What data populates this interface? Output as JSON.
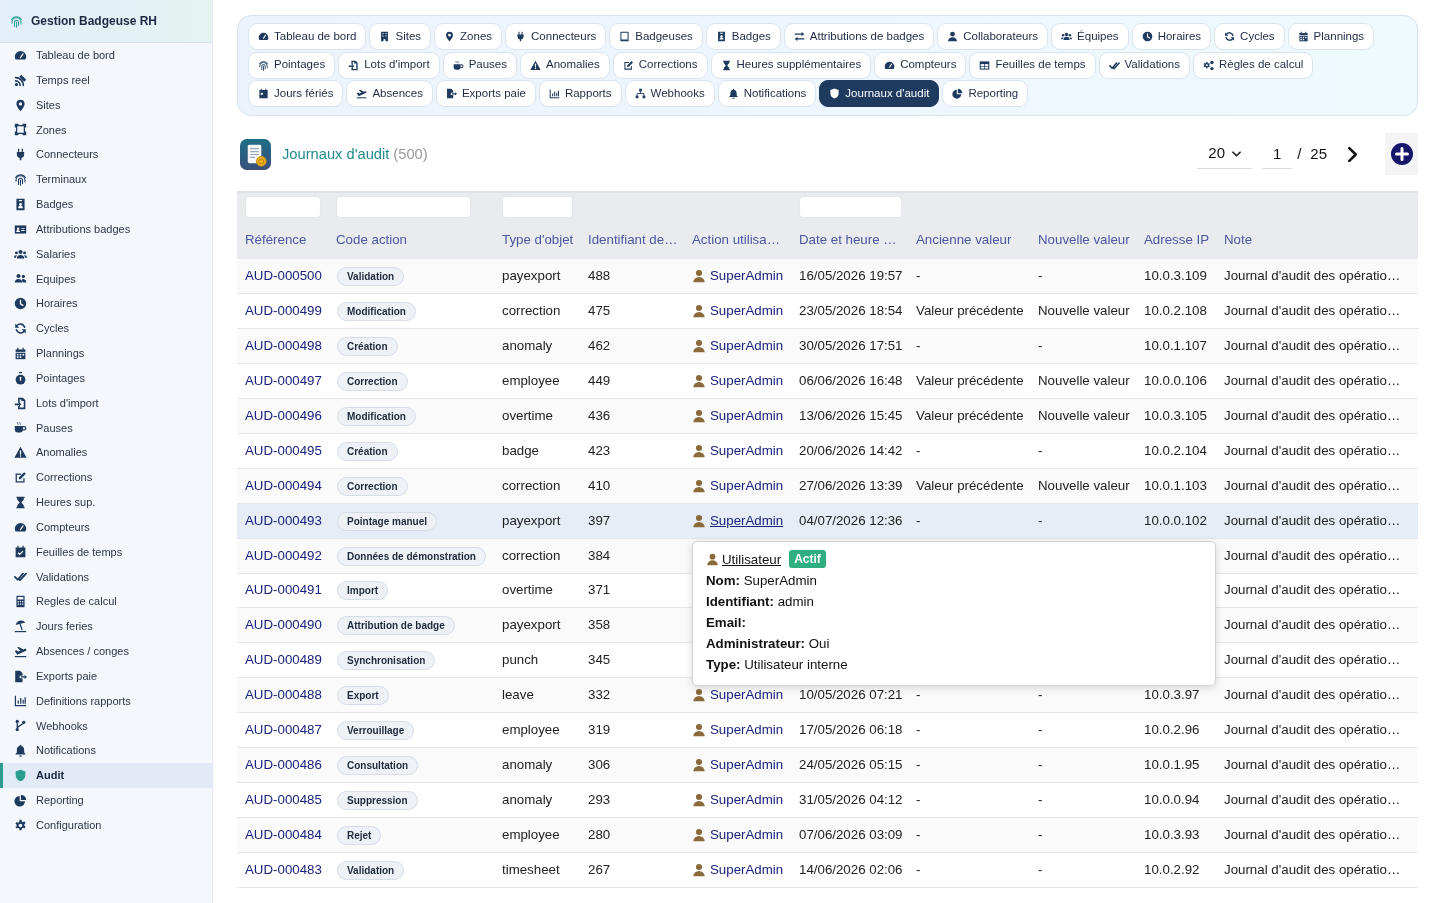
{
  "sidebar": {
    "title": "Gestion Badgeuse RH",
    "items": [
      {
        "label": "Tableau de bord",
        "selected": false
      },
      {
        "label": "Temps reel",
        "selected": false
      },
      {
        "label": "Sites",
        "selected": false
      },
      {
        "label": "Zones",
        "selected": false
      },
      {
        "label": "Connecteurs",
        "selected": false
      },
      {
        "label": "Terminaux",
        "selected": false
      },
      {
        "label": "Badges",
        "selected": false
      },
      {
        "label": "Attributions badges",
        "selected": false
      },
      {
        "label": "Salaries",
        "selected": false
      },
      {
        "label": "Equipes",
        "selected": false
      },
      {
        "label": "Horaires",
        "selected": false
      },
      {
        "label": "Cycles",
        "selected": false
      },
      {
        "label": "Plannings",
        "selected": false
      },
      {
        "label": "Pointages",
        "selected": false
      },
      {
        "label": "Lots d'import",
        "selected": false
      },
      {
        "label": "Pauses",
        "selected": false
      },
      {
        "label": "Anomalies",
        "selected": false
      },
      {
        "label": "Corrections",
        "selected": false
      },
      {
        "label": "Heures sup.",
        "selected": false
      },
      {
        "label": "Compteurs",
        "selected": false
      },
      {
        "label": "Feuilles de temps",
        "selected": false
      },
      {
        "label": "Validations",
        "selected": false
      },
      {
        "label": "Regles de calcul",
        "selected": false
      },
      {
        "label": "Jours feries",
        "selected": false
      },
      {
        "label": "Absences / conges",
        "selected": false
      },
      {
        "label": "Exports paie",
        "selected": false
      },
      {
        "label": "Definitions rapports",
        "selected": false
      },
      {
        "label": "Webhooks",
        "selected": false
      },
      {
        "label": "Notifications",
        "selected": false
      },
      {
        "label": "Audit",
        "selected": true
      },
      {
        "label": "Reporting",
        "selected": false
      },
      {
        "label": "Configuration",
        "selected": false
      }
    ]
  },
  "tab_rows": [
    [
      {
        "label": "Tableau de bord",
        "selected": false
      },
      {
        "label": "Sites",
        "selected": false
      },
      {
        "label": "Zones",
        "selected": false
      },
      {
        "label": "Connecteurs",
        "selected": false
      },
      {
        "label": "Badgeuses",
        "selected": false
      },
      {
        "label": "Badges",
        "selected": false
      },
      {
        "label": "Attributions de badges",
        "selected": false
      },
      {
        "label": "Collaborateurs",
        "selected": false
      },
      {
        "label": "Équipes",
        "selected": false
      },
      {
        "label": "Horaires",
        "selected": false
      },
      {
        "label": "Cycles",
        "selected": false
      },
      {
        "label": "Plannings",
        "selected": false
      }
    ],
    [
      {
        "label": "Pointages",
        "selected": false
      },
      {
        "label": "Lots d'import",
        "selected": false
      },
      {
        "label": "Pauses",
        "selected": false
      },
      {
        "label": "Anomalies",
        "selected": false
      },
      {
        "label": "Corrections",
        "selected": false
      },
      {
        "label": "Heures supplémentaires",
        "selected": false
      },
      {
        "label": "Compteurs",
        "selected": false
      },
      {
        "label": "Feuilles de temps",
        "selected": false
      },
      {
        "label": "Validations",
        "selected": false
      },
      {
        "label": "Règles de calcul",
        "selected": false
      }
    ],
    [
      {
        "label": "Jours fériés",
        "selected": false
      },
      {
        "label": "Absences",
        "selected": false
      },
      {
        "label": "Exports paie",
        "selected": false
      },
      {
        "label": "Rapports",
        "selected": false
      },
      {
        "label": "Webhooks",
        "selected": false
      },
      {
        "label": "Notifications",
        "selected": false
      },
      {
        "label": "Journaux d'audit",
        "selected": true
      },
      {
        "label": "Reporting",
        "selected": false
      }
    ]
  ],
  "page": {
    "title": "Journaux d'audit",
    "count": "(500)"
  },
  "pagination": {
    "page_size": "20",
    "page": "1",
    "separator": "/",
    "total_pages": "25"
  },
  "table": {
    "columns": [
      {
        "label": "Référence",
        "filter": true
      },
      {
        "label": "Code action",
        "filter": true
      },
      {
        "label": "Type d'objet",
        "filter": true
      },
      {
        "label": "Identifiant de…",
        "filter": false
      },
      {
        "label": "Action utilisa…",
        "filter": false
      },
      {
        "label": "Date et heure …",
        "filter": true
      },
      {
        "label": "Ancienne valeur",
        "filter": false
      },
      {
        "label": "Nouvelle valeur",
        "filter": false
      },
      {
        "label": "Adresse IP",
        "filter": false
      },
      {
        "label": "Note",
        "filter": false
      }
    ],
    "rows": [
      {
        "reference": "AUD-000500",
        "action": "Validation",
        "object_type": "payexport",
        "object_id": "488",
        "user": "SuperAdmin",
        "date": "16/05/2026 19:57",
        "old_value": "-",
        "new_value": "-",
        "ip": "10.0.3.109",
        "note": "Journal d'audit des opératio…",
        "highlighted": false
      },
      {
        "reference": "AUD-000499",
        "action": "Modification",
        "object_type": "correction",
        "object_id": "475",
        "user": "SuperAdmin",
        "date": "23/05/2026 18:54",
        "old_value": "Valeur précédente",
        "new_value": "Nouvelle valeur",
        "ip": "10.0.2.108",
        "note": "Journal d'audit des opératio…",
        "highlighted": false
      },
      {
        "reference": "AUD-000498",
        "action": "Création",
        "object_type": "anomaly",
        "object_id": "462",
        "user": "SuperAdmin",
        "date": "30/05/2026 17:51",
        "old_value": "-",
        "new_value": "-",
        "ip": "10.0.1.107",
        "note": "Journal d'audit des opératio…",
        "highlighted": false
      },
      {
        "reference": "AUD-000497",
        "action": "Correction",
        "object_type": "employee",
        "object_id": "449",
        "user": "SuperAdmin",
        "date": "06/06/2026 16:48",
        "old_value": "Valeur précédente",
        "new_value": "Nouvelle valeur",
        "ip": "10.0.0.106",
        "note": "Journal d'audit des opératio…",
        "highlighted": false
      },
      {
        "reference": "AUD-000496",
        "action": "Modification",
        "object_type": "overtime",
        "object_id": "436",
        "user": "SuperAdmin",
        "date": "13/06/2026 15:45",
        "old_value": "Valeur précédente",
        "new_value": "Nouvelle valeur",
        "ip": "10.0.3.105",
        "note": "Journal d'audit des opératio…",
        "highlighted": false
      },
      {
        "reference": "AUD-000495",
        "action": "Création",
        "object_type": "badge",
        "object_id": "423",
        "user": "SuperAdmin",
        "date": "20/06/2026 14:42",
        "old_value": "-",
        "new_value": "-",
        "ip": "10.0.2.104",
        "note": "Journal d'audit des opératio…",
        "highlighted": false
      },
      {
        "reference": "AUD-000494",
        "action": "Correction",
        "object_type": "correction",
        "object_id": "410",
        "user": "SuperAdmin",
        "date": "27/06/2026 13:39",
        "old_value": "Valeur précédente",
        "new_value": "Nouvelle valeur",
        "ip": "10.0.1.103",
        "note": "Journal d'audit des opératio…",
        "highlighted": false
      },
      {
        "reference": "AUD-000493",
        "action": "Pointage manuel",
        "object_type": "payexport",
        "object_id": "397",
        "user": "SuperAdmin",
        "date": "04/07/2026 12:36",
        "old_value": "-",
        "new_value": "-",
        "ip": "10.0.0.102",
        "note": "Journal d'audit des opératio…",
        "highlighted": true
      },
      {
        "reference": "AUD-000492",
        "action": "Données de démonstration",
        "object_type": "correction",
        "object_id": "384",
        "note": "Journal d'audit des opératio…",
        "highlighted": false
      },
      {
        "reference": "AUD-000491",
        "action": "Import",
        "object_type": "overtime",
        "object_id": "371",
        "note": "Journal d'audit des opératio…",
        "highlighted": false
      },
      {
        "reference": "AUD-000490",
        "action": "Attribution de badge",
        "object_type": "payexport",
        "object_id": "358",
        "note": "Journal d'audit des opératio…",
        "highlighted": false
      },
      {
        "reference": "AUD-000489",
        "action": "Synchronisation",
        "object_type": "punch",
        "object_id": "345",
        "note": "Journal d'audit des opératio…",
        "highlighted": false
      },
      {
        "reference": "AUD-000488",
        "action": "Export",
        "object_type": "leave",
        "object_id": "332",
        "user": "SuperAdmin",
        "date": "10/05/2026 07:21",
        "old_value": "-",
        "new_value": "-",
        "ip": "10.0.3.97",
        "note": "Journal d'audit des opératio…",
        "highlighted": false
      },
      {
        "reference": "AUD-000487",
        "action": "Verrouillage",
        "object_type": "employee",
        "object_id": "319",
        "user": "SuperAdmin",
        "date": "17/05/2026 06:18",
        "old_value": "-",
        "new_value": "-",
        "ip": "10.0.2.96",
        "note": "Journal d'audit des opératio…",
        "highlighted": false
      },
      {
        "reference": "AUD-000486",
        "action": "Consultation",
        "object_type": "anomaly",
        "object_id": "306",
        "user": "SuperAdmin",
        "date": "24/05/2026 05:15",
        "old_value": "-",
        "new_value": "-",
        "ip": "10.0.1.95",
        "note": "Journal d'audit des opératio…",
        "highlighted": false
      },
      {
        "reference": "AUD-000485",
        "action": "Suppression",
        "object_type": "anomaly",
        "object_id": "293",
        "user": "SuperAdmin",
        "date": "31/05/2026 04:12",
        "old_value": "-",
        "new_value": "-",
        "ip": "10.0.0.94",
        "note": "Journal d'audit des opératio…",
        "highlighted": false
      },
      {
        "reference": "AUD-000484",
        "action": "Rejet",
        "object_type": "employee",
        "object_id": "280",
        "user": "SuperAdmin",
        "date": "07/06/2026 03:09",
        "old_value": "-",
        "new_value": "-",
        "ip": "10.0.3.93",
        "note": "Journal d'audit des opératio…",
        "highlighted": false
      },
      {
        "reference": "AUD-000483",
        "action": "Validation",
        "object_type": "timesheet",
        "object_id": "267",
        "user": "SuperAdmin",
        "date": "14/06/2026 02:06",
        "old_value": "-",
        "new_value": "-",
        "ip": "10.0.2.92",
        "note": "Journal d'audit des opératio…",
        "highlighted": false
      }
    ]
  },
  "tooltip": {
    "title": "Utilisateur",
    "status": "Actif",
    "fields": [
      {
        "label": "Nom:",
        "value": "SuperAdmin"
      },
      {
        "label": "Identifiant:",
        "value": "admin"
      },
      {
        "label": "Email:"
      },
      {
        "label": "Administrateur:",
        "value": "Oui"
      },
      {
        "label": "Type:",
        "value": "Utilisateur interne"
      }
    ]
  }
}
